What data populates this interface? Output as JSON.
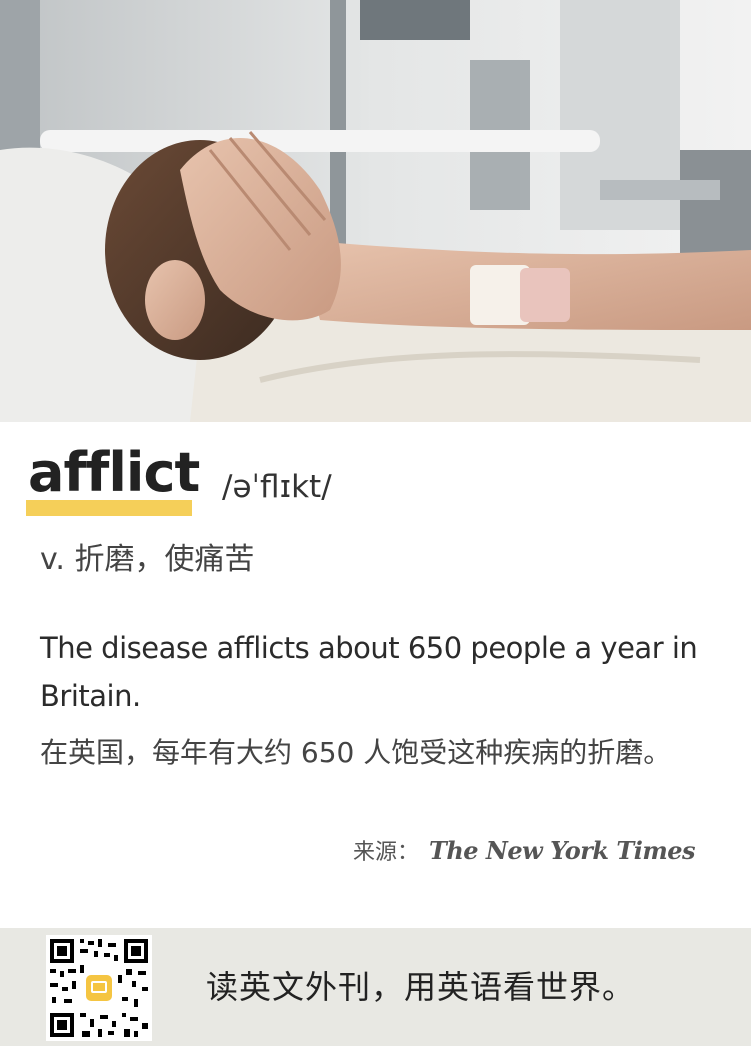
{
  "card": {
    "word": "afflict",
    "phonetic": "/əˈflɪkt/",
    "definition": "v. 折磨，使痛苦",
    "example_en": "The disease afflicts about 650 people a year in Britain.",
    "example_zh": "在英国，每年有大约 650 人饱受这种疾病的折磨。",
    "source_label": "来源：",
    "source_name": "The New York Times"
  },
  "footer": {
    "slogan": "读英文外刊，用英语看世界。"
  },
  "colors": {
    "highlight": "#f5cf59",
    "footer_bg": "#e8e8e3"
  }
}
